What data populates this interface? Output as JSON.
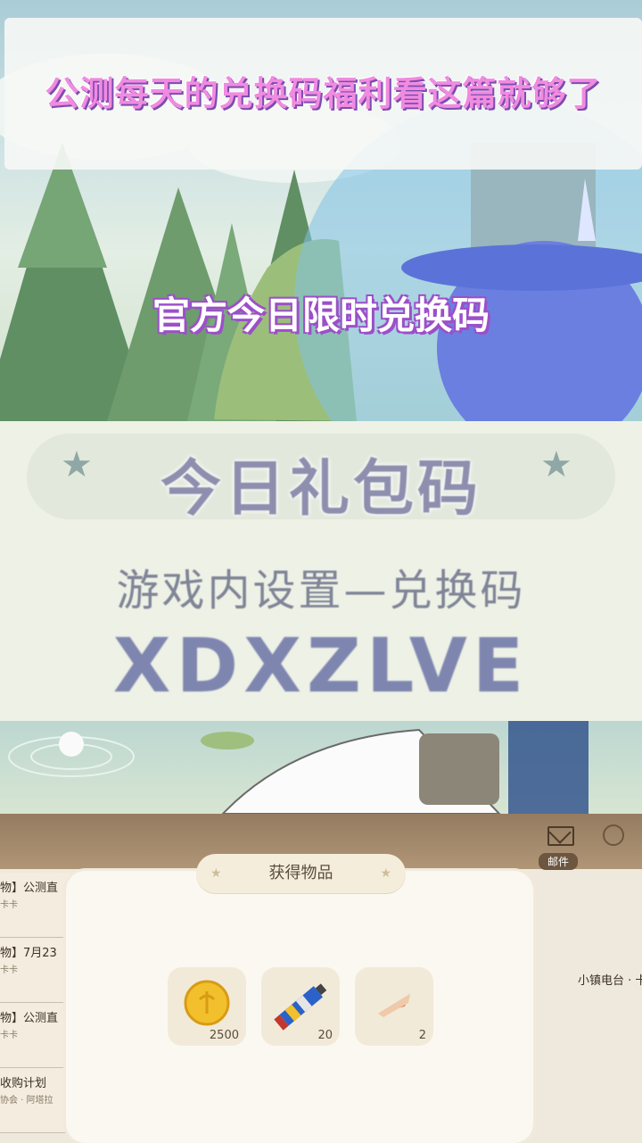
{
  "hero": {
    "title": "公测每天的兑换码福利看这篇就够了",
    "overlay": "官方今日限时兑换码"
  },
  "gift_code_card": {
    "heading": "今日礼包码",
    "instruction": "游戏内设置—兑换码",
    "code": "XDXZLVE"
  },
  "game_ui": {
    "mail_tab": "邮件",
    "side_items": [
      {
        "title": "物】公测直",
        "sub": "卡卡"
      },
      {
        "title": "物】7月23",
        "sub": "卡卡"
      },
      {
        "title": "物】公测直",
        "sub": "卡卡"
      },
      {
        "title": "收购计划",
        "sub": "协会 · 阿塔拉"
      }
    ],
    "radio_label": "小镇电台 · 卡",
    "modal": {
      "title": "获得物品",
      "items": [
        {
          "icon": "gold-coin-icon",
          "qty": "2500"
        },
        {
          "icon": "paint-tube-icon",
          "qty": "20"
        },
        {
          "icon": "ice-cream-cone-icon",
          "qty": "2"
        }
      ]
    }
  },
  "colors": {
    "title_pink": "#f08be0",
    "title_outline": "#7b4bb0",
    "code_blue": "#7e86b0"
  }
}
